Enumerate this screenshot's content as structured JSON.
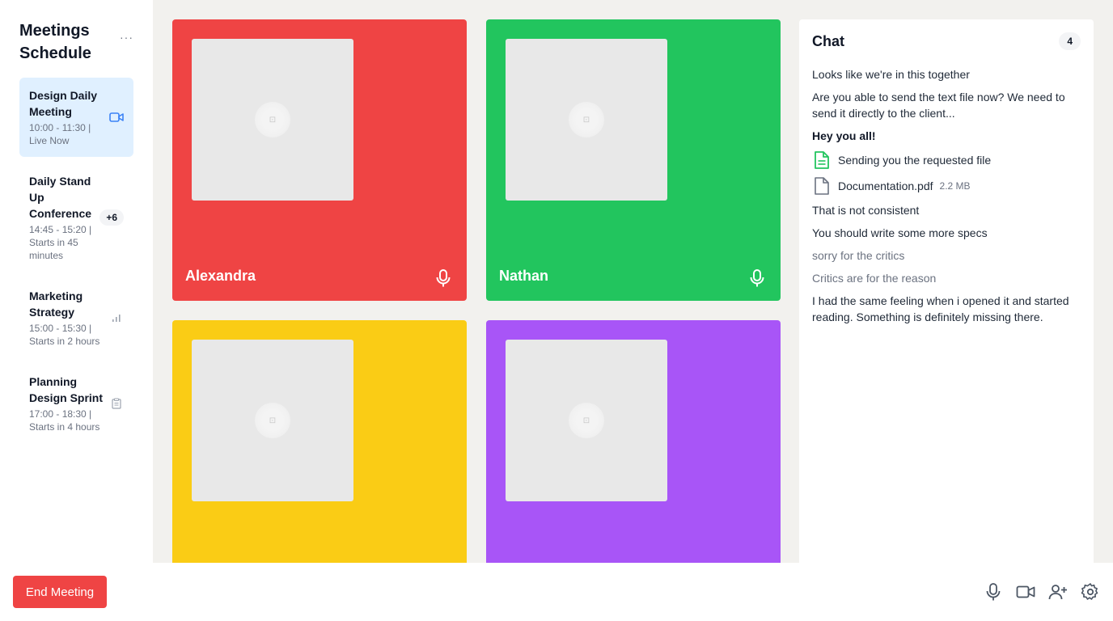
{
  "sidebar": {
    "title": "Meetings Schedule",
    "more_icon": "more-horizontal-icon",
    "meetings": [
      {
        "name": "Design Daily Meeting",
        "time": "10:00 - 11:30 | Live Now",
        "icon": "video-icon",
        "active": true
      },
      {
        "name": "Daily Stand Up Conference",
        "time": "14:45 - 15:20 | Starts in 45 minutes",
        "badge": "+6"
      },
      {
        "name": "Marketing Strategy",
        "time": "15:00 - 15:30 | Starts in 2 hours",
        "icon": "bar-chart-icon"
      },
      {
        "name": "Planning Design Sprint",
        "time": "17:00 - 18:30 | Starts in 4 hours",
        "icon": "clipboard-icon"
      }
    ]
  },
  "participants": [
    {
      "name": "Alexandra",
      "color": "#ef4444",
      "mic": true
    },
    {
      "name": "Nathan",
      "color": "#22c55e",
      "mic": true
    },
    {
      "name": "",
      "color": "#facc15",
      "mic": false
    },
    {
      "name": "",
      "color": "#a855f7",
      "mic": false
    }
  ],
  "chat": {
    "title": "Chat",
    "count": "4",
    "messages": [
      "Looks like we're in this together",
      "Are you able to send the text file now? We need to send it directly to the client..."
    ],
    "greeting": "Hey you all!",
    "file_message": "Sending you the requested file",
    "attachment": {
      "name": "Documentation.pdf",
      "size": "2.2 MB"
    },
    "messages_after": [
      "That is not consistent",
      "You should write some more specs"
    ],
    "muted_messages": [
      "sorry for the critics",
      "Critics are for the reason"
    ],
    "last_message": "I had the same feeling when i opened it and started reading. Something is definitely missing there."
  },
  "bottom_bar": {
    "end_label": "End Meeting",
    "controls": [
      "microphone-icon",
      "video-camera-icon",
      "add-user-icon",
      "settings-icon"
    ]
  },
  "colors": {
    "accent_red": "#ef4444",
    "active_bg": "#e0f0ff",
    "icon_blue": "#3b82f6",
    "file_green": "#22c55e"
  }
}
